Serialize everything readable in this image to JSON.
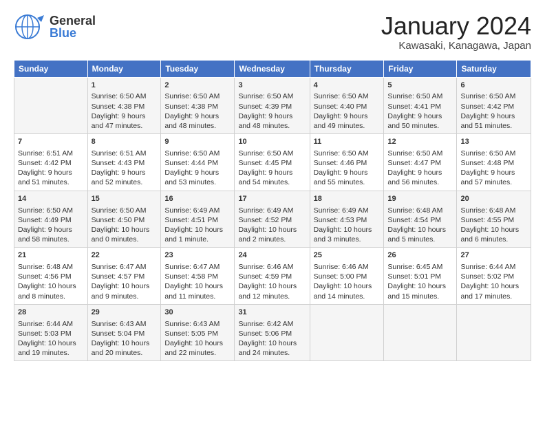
{
  "logo": {
    "general": "General",
    "blue": "Blue"
  },
  "title": "January 2024",
  "location": "Kawasaki, Kanagawa, Japan",
  "weekdays": [
    "Sunday",
    "Monday",
    "Tuesday",
    "Wednesday",
    "Thursday",
    "Friday",
    "Saturday"
  ],
  "weeks": [
    [
      {
        "day": "",
        "info": ""
      },
      {
        "day": "1",
        "info": "Sunrise: 6:50 AM\nSunset: 4:38 PM\nDaylight: 9 hours\nand 47 minutes."
      },
      {
        "day": "2",
        "info": "Sunrise: 6:50 AM\nSunset: 4:38 PM\nDaylight: 9 hours\nand 48 minutes."
      },
      {
        "day": "3",
        "info": "Sunrise: 6:50 AM\nSunset: 4:39 PM\nDaylight: 9 hours\nand 48 minutes."
      },
      {
        "day": "4",
        "info": "Sunrise: 6:50 AM\nSunset: 4:40 PM\nDaylight: 9 hours\nand 49 minutes."
      },
      {
        "day": "5",
        "info": "Sunrise: 6:50 AM\nSunset: 4:41 PM\nDaylight: 9 hours\nand 50 minutes."
      },
      {
        "day": "6",
        "info": "Sunrise: 6:50 AM\nSunset: 4:42 PM\nDaylight: 9 hours\nand 51 minutes."
      }
    ],
    [
      {
        "day": "7",
        "info": "Sunrise: 6:51 AM\nSunset: 4:42 PM\nDaylight: 9 hours\nand 51 minutes."
      },
      {
        "day": "8",
        "info": "Sunrise: 6:51 AM\nSunset: 4:43 PM\nDaylight: 9 hours\nand 52 minutes."
      },
      {
        "day": "9",
        "info": "Sunrise: 6:50 AM\nSunset: 4:44 PM\nDaylight: 9 hours\nand 53 minutes."
      },
      {
        "day": "10",
        "info": "Sunrise: 6:50 AM\nSunset: 4:45 PM\nDaylight: 9 hours\nand 54 minutes."
      },
      {
        "day": "11",
        "info": "Sunrise: 6:50 AM\nSunset: 4:46 PM\nDaylight: 9 hours\nand 55 minutes."
      },
      {
        "day": "12",
        "info": "Sunrise: 6:50 AM\nSunset: 4:47 PM\nDaylight: 9 hours\nand 56 minutes."
      },
      {
        "day": "13",
        "info": "Sunrise: 6:50 AM\nSunset: 4:48 PM\nDaylight: 9 hours\nand 57 minutes."
      }
    ],
    [
      {
        "day": "14",
        "info": "Sunrise: 6:50 AM\nSunset: 4:49 PM\nDaylight: 9 hours\nand 58 minutes."
      },
      {
        "day": "15",
        "info": "Sunrise: 6:50 AM\nSunset: 4:50 PM\nDaylight: 10 hours\nand 0 minutes."
      },
      {
        "day": "16",
        "info": "Sunrise: 6:49 AM\nSunset: 4:51 PM\nDaylight: 10 hours\nand 1 minute."
      },
      {
        "day": "17",
        "info": "Sunrise: 6:49 AM\nSunset: 4:52 PM\nDaylight: 10 hours\nand 2 minutes."
      },
      {
        "day": "18",
        "info": "Sunrise: 6:49 AM\nSunset: 4:53 PM\nDaylight: 10 hours\nand 3 minutes."
      },
      {
        "day": "19",
        "info": "Sunrise: 6:48 AM\nSunset: 4:54 PM\nDaylight: 10 hours\nand 5 minutes."
      },
      {
        "day": "20",
        "info": "Sunrise: 6:48 AM\nSunset: 4:55 PM\nDaylight: 10 hours\nand 6 minutes."
      }
    ],
    [
      {
        "day": "21",
        "info": "Sunrise: 6:48 AM\nSunset: 4:56 PM\nDaylight: 10 hours\nand 8 minutes."
      },
      {
        "day": "22",
        "info": "Sunrise: 6:47 AM\nSunset: 4:57 PM\nDaylight: 10 hours\nand 9 minutes."
      },
      {
        "day": "23",
        "info": "Sunrise: 6:47 AM\nSunset: 4:58 PM\nDaylight: 10 hours\nand 11 minutes."
      },
      {
        "day": "24",
        "info": "Sunrise: 6:46 AM\nSunset: 4:59 PM\nDaylight: 10 hours\nand 12 minutes."
      },
      {
        "day": "25",
        "info": "Sunrise: 6:46 AM\nSunset: 5:00 PM\nDaylight: 10 hours\nand 14 minutes."
      },
      {
        "day": "26",
        "info": "Sunrise: 6:45 AM\nSunset: 5:01 PM\nDaylight: 10 hours\nand 15 minutes."
      },
      {
        "day": "27",
        "info": "Sunrise: 6:44 AM\nSunset: 5:02 PM\nDaylight: 10 hours\nand 17 minutes."
      }
    ],
    [
      {
        "day": "28",
        "info": "Sunrise: 6:44 AM\nSunset: 5:03 PM\nDaylight: 10 hours\nand 19 minutes."
      },
      {
        "day": "29",
        "info": "Sunrise: 6:43 AM\nSunset: 5:04 PM\nDaylight: 10 hours\nand 20 minutes."
      },
      {
        "day": "30",
        "info": "Sunrise: 6:43 AM\nSunset: 5:05 PM\nDaylight: 10 hours\nand 22 minutes."
      },
      {
        "day": "31",
        "info": "Sunrise: 6:42 AM\nSunset: 5:06 PM\nDaylight: 10 hours\nand 24 minutes."
      },
      {
        "day": "",
        "info": ""
      },
      {
        "day": "",
        "info": ""
      },
      {
        "day": "",
        "info": ""
      }
    ]
  ]
}
